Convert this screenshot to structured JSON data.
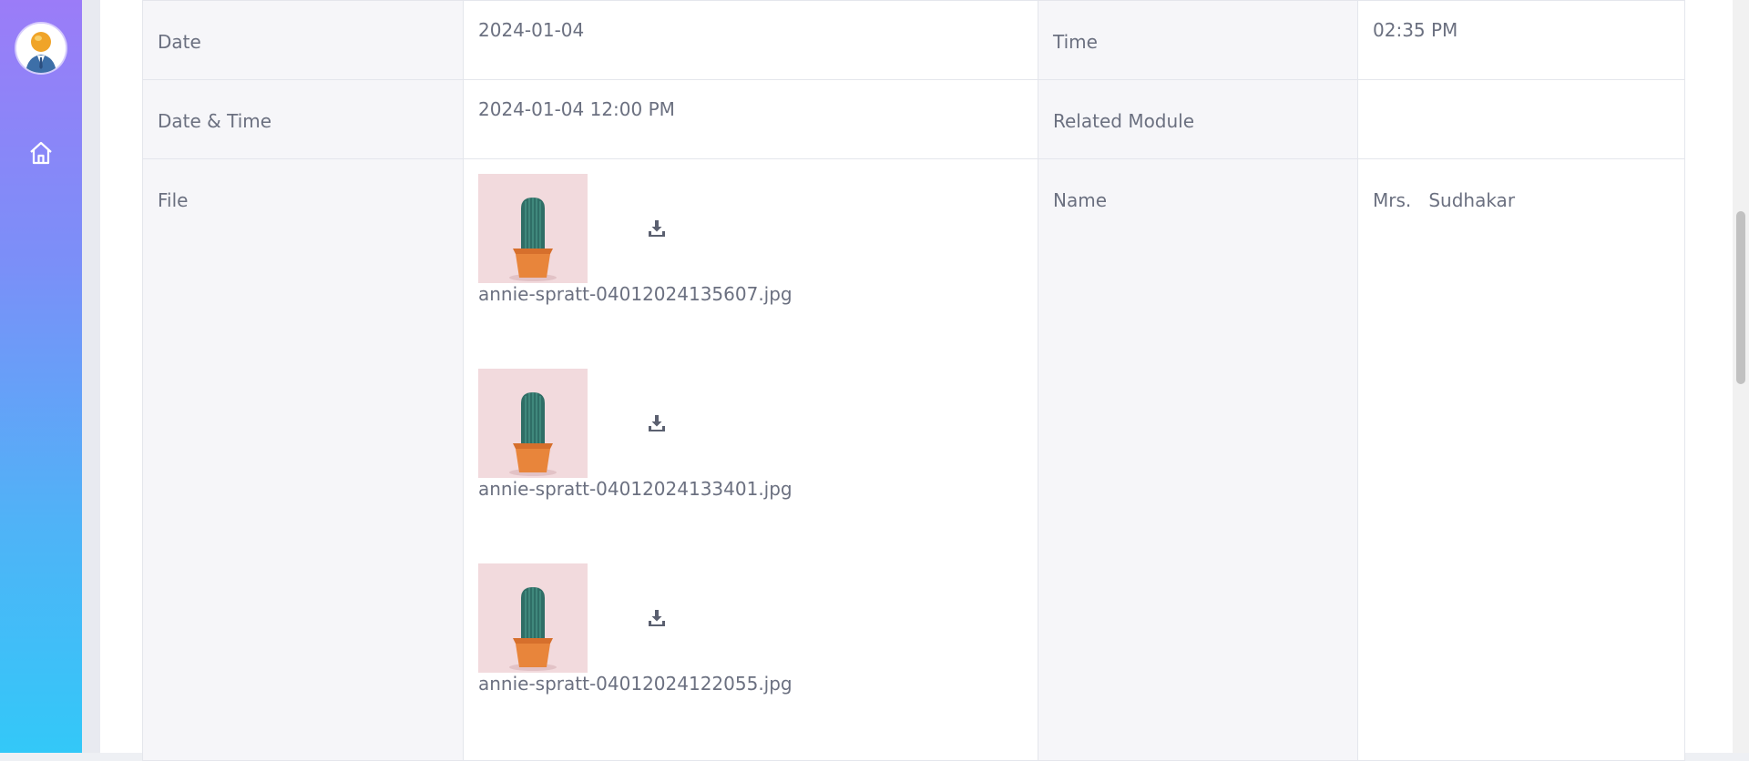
{
  "sidebar": {
    "avatar_icon": "user-avatar-icon",
    "home_icon": "home-icon"
  },
  "detail": {
    "date": {
      "label": "Date",
      "value": "2024-01-04"
    },
    "time": {
      "label": "Time",
      "value": "02:35 PM"
    },
    "datetime": {
      "label": "Date & Time",
      "value": "2024-01-04 12:00 PM"
    },
    "related_module": {
      "label": "Related Module",
      "value": ""
    },
    "file": {
      "label": "File",
      "items": [
        {
          "name": "annie-spratt-04012024135607.jpg"
        },
        {
          "name": "annie-spratt-04012024133401.jpg"
        },
        {
          "name": "annie-spratt-04012024122055.jpg"
        }
      ]
    },
    "name": {
      "label": "Name",
      "value": "Mrs.   Sudhakar"
    }
  },
  "colors": {
    "sidebar_gradient_top": "#9b7cf8",
    "sidebar_gradient_bottom": "#33c8f8",
    "label_bg": "#f6f6f9",
    "text": "#6b7080"
  }
}
